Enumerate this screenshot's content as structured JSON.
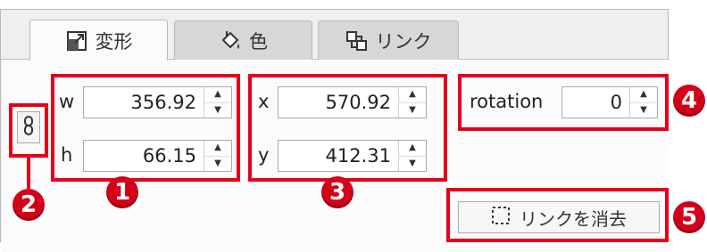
{
  "tabs": [
    {
      "label": "変形",
      "icon": "transform-icon",
      "active": true
    },
    {
      "label": "色",
      "icon": "paint-bucket-icon",
      "active": false
    },
    {
      "label": "リンク",
      "icon": "link-icon",
      "active": false
    }
  ],
  "size": {
    "w_label": "w",
    "w_value": "356.92",
    "h_label": "h",
    "h_value": "66.15"
  },
  "position": {
    "x_label": "x",
    "x_value": "570.92",
    "y_label": "y",
    "y_value": "412.31"
  },
  "rotation": {
    "label": "rotation",
    "value": "0"
  },
  "unlink_button": {
    "label": "リンクを消去",
    "icon": "dashed-square-icon"
  },
  "callouts": [
    "1",
    "2",
    "3",
    "4",
    "5"
  ],
  "colors": {
    "highlight": "#e4001b",
    "badge": "#d3001a",
    "panel_bg": "#efefef"
  }
}
